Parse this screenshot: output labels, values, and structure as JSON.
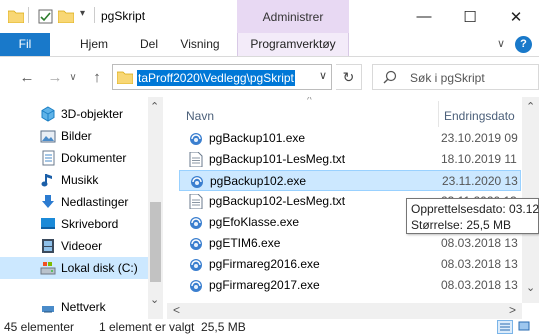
{
  "title_bar": {
    "window_title": "pgSkript",
    "context_tab_group": "Administrer",
    "minimize_glyph": "—",
    "maximize_glyph": "☐",
    "close_glyph": "✕"
  },
  "ribbon": {
    "tabs": [
      {
        "label": "Fil",
        "active": true
      },
      {
        "label": "Hjem"
      },
      {
        "label": "Del"
      },
      {
        "label": "Visning"
      },
      {
        "label": "Programverktøy",
        "contextual": true
      }
    ],
    "collapse_glyph": "∨",
    "help_glyph": "?"
  },
  "address_bar": {
    "path": "taProff2020\\Vedlegg\\pgSkript",
    "dropdown_glyph": "∨",
    "refresh_glyph": "↻"
  },
  "search": {
    "placeholder": "Søk i pgSkript"
  },
  "nav": {
    "back_glyph": "←",
    "forward_glyph": "→",
    "history_glyph": "∨",
    "up_glyph": "↑",
    "scroll_up_glyph": "⌃",
    "scroll_down_glyph": "⌄",
    "items": [
      {
        "label": "3D-objekter",
        "icon": "3d-objects-icon"
      },
      {
        "label": "Bilder",
        "icon": "pictures-icon"
      },
      {
        "label": "Dokumenter",
        "icon": "documents-icon"
      },
      {
        "label": "Musikk",
        "icon": "music-icon"
      },
      {
        "label": "Nedlastinger",
        "icon": "downloads-icon"
      },
      {
        "label": "Skrivebord",
        "icon": "desktop-icon"
      },
      {
        "label": "Videoer",
        "icon": "videos-icon"
      },
      {
        "label": "Lokal disk (C:)",
        "icon": "local-disk-icon",
        "selected": true
      },
      {
        "label": "Nettverk",
        "icon": "network-icon"
      }
    ]
  },
  "file_list": {
    "columns": {
      "name": "Navn",
      "date": "Endringsdato"
    },
    "sort_glyph": "^",
    "files": [
      {
        "name": "pgBackup101.exe",
        "date": "23.10.2019 09",
        "type": "exe"
      },
      {
        "name": "pgBackup101-LesMeg.txt",
        "date": "18.10.2019 11",
        "type": "txt"
      },
      {
        "name": "pgBackup102.exe",
        "date": "23.11.2020 13",
        "type": "exe",
        "selected": true
      },
      {
        "name": "pgBackup102-LesMeg.txt",
        "date": "23.11.2020 13",
        "type": "txt"
      },
      {
        "name": "pgEfoKlasse.exe",
        "date": "",
        "type": "exe"
      },
      {
        "name": "pgETIM6.exe",
        "date": "08.03.2018 13",
        "type": "exe"
      },
      {
        "name": "pgFirmareg2016.exe",
        "date": "08.03.2018 13",
        "type": "exe"
      },
      {
        "name": "pgFirmareg2017.exe",
        "date": "08.03.2018 13",
        "type": "exe"
      }
    ],
    "scroll_left_glyph": "<",
    "scroll_right_glyph": ">"
  },
  "tooltip": {
    "line1": "Opprettelsesdato: 03.12.",
    "line2": "Størrelse: 25,5 MB"
  },
  "status_bar": {
    "item_count": "45 elementer",
    "selection": "1 element er valgt  25,5 MB"
  },
  "colors": {
    "accent": "#0078d7",
    "file_tab": "#1979ca",
    "context_tab": "#e8d9f3",
    "selection": "#cce8ff",
    "folder": "#f8d775"
  }
}
